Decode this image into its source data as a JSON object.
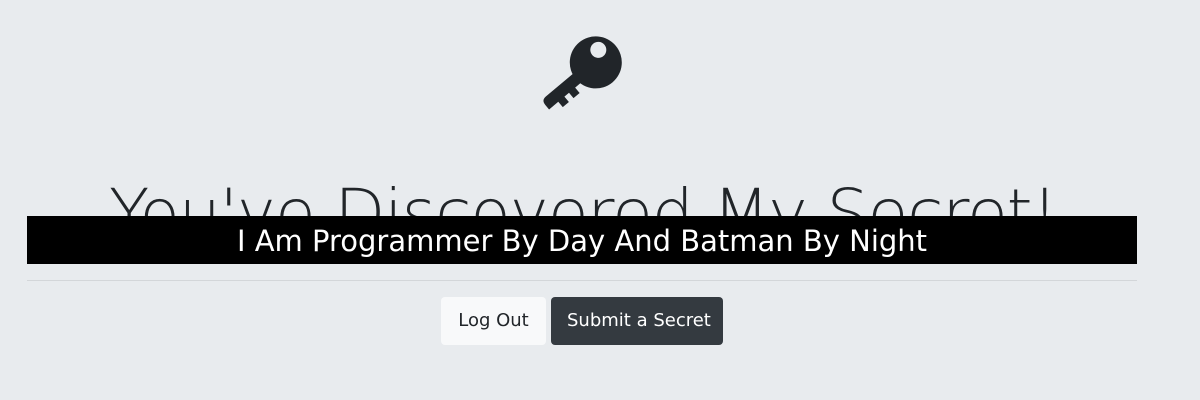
{
  "hero": {
    "icon": "key-icon",
    "title": "You've Discovered My Secret!",
    "secret": "I Am Programmer By Day And Batman By Night"
  },
  "actions": {
    "logout_label": "Log Out",
    "submit_label": "Submit a Secret"
  },
  "colors": {
    "background": "#e8ebee",
    "banner": "#000000",
    "dark_button": "#343a40",
    "light_button": "#f8f9fa"
  }
}
